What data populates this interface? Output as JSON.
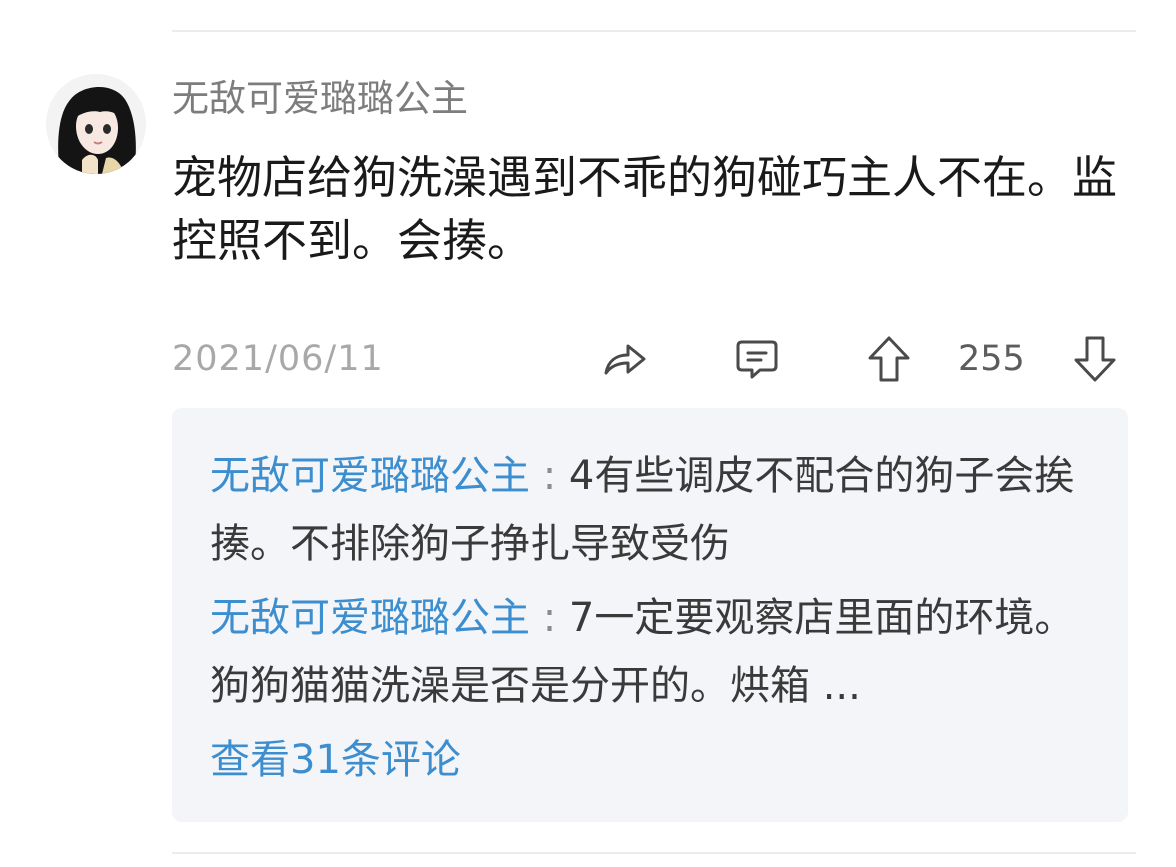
{
  "comment": {
    "username": "无敌可爱璐璐公主",
    "text": "宠物店给狗洗澡遇到不乖的狗碰巧主人不在。监控照不到。会揍。",
    "date": "2021/06/11",
    "vote_count": "255"
  },
  "icons": {
    "share": "share-arrow-icon",
    "comment": "comment-bubble-icon",
    "upvote": "up-arrow-icon",
    "downvote": "down-arrow-icon"
  },
  "replies": [
    {
      "username": "无敌可爱璐璐公主",
      "separator": " : ",
      "text": "4有些调皮不配合的狗子会挨揍。不排除狗子挣扎导致受伤"
    },
    {
      "username": "无敌可爱璐璐公主",
      "separator": " : ",
      "text": "7一定要观察店里面的环境。狗狗猫猫洗澡是否是分开的。烘箱 ..."
    }
  ],
  "view_more_label": "查看31条评论",
  "colors": {
    "link_blue": "#3c8ecf",
    "reply_background": "#f4f5f9",
    "muted_text": "#a8a8a8"
  }
}
